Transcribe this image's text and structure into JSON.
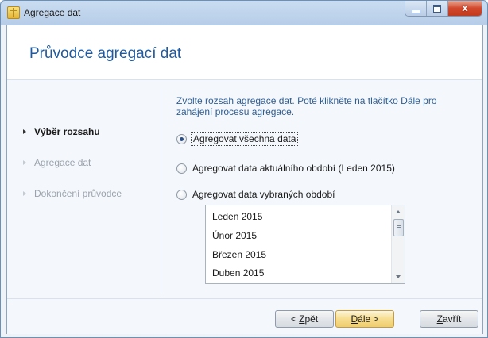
{
  "window": {
    "title": "Agregace dat",
    "controls": {
      "close_glyph": "x"
    }
  },
  "header": {
    "title": "Průvodce agregací dat"
  },
  "steps": [
    {
      "label": "Výběr rozsahu",
      "state": "active"
    },
    {
      "label": "Agregace dat",
      "state": "inactive"
    },
    {
      "label": "Dokončení průvodce",
      "state": "inactive"
    }
  ],
  "content": {
    "instruction": "Zvolte rozsah agregace dat. Poté klikněte na tlačítko Dále pro zahájení procesu agregace.",
    "options": [
      {
        "label": "Agregovat všechna data",
        "checked": true
      },
      {
        "label": "Agregovat data aktuálního období (Leden 2015)",
        "checked": false
      },
      {
        "label": "Agregovat data vybraných období",
        "checked": false
      }
    ],
    "periods": [
      "Leden 2015",
      "Únor 2015",
      "Březen 2015",
      "Duben 2015"
    ]
  },
  "buttons": {
    "back": {
      "prefix": "< ",
      "mnemonic": "Z",
      "rest": "pět"
    },
    "next": {
      "mnemonic": "D",
      "rest": "ále >"
    },
    "close": {
      "mnemonic": "Z",
      "rest": "avřít"
    }
  },
  "colors": {
    "accent": "#1e5aa0",
    "instruction": "#2d5e95"
  },
  "icons": [
    "app-icon",
    "minimize-icon",
    "maximize-icon",
    "close-icon",
    "radio-icon",
    "scroll-up-icon",
    "scroll-down-icon"
  ]
}
